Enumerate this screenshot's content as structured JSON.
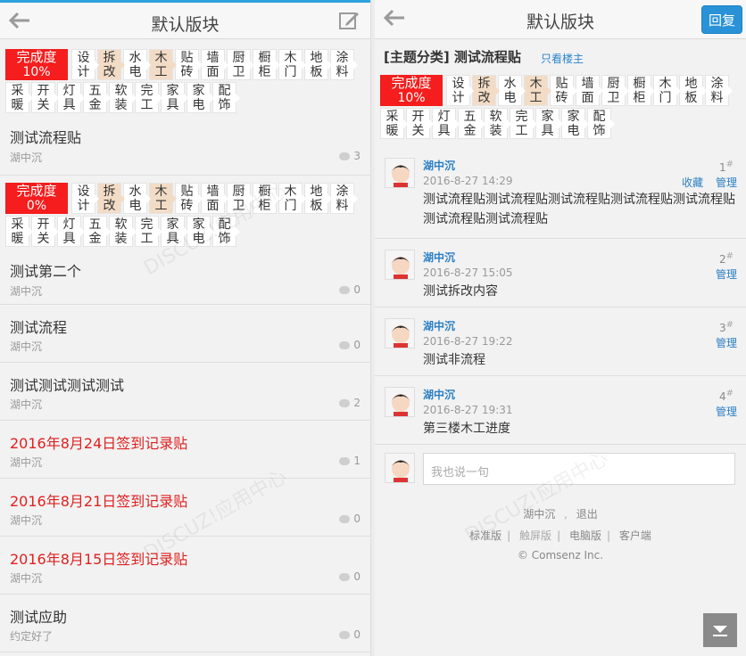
{
  "left": {
    "title": "默认版块",
    "threads": [
      {
        "title": "测试流程贴",
        "author": "湖中沉",
        "replies": "3",
        "red": false,
        "completion": {
          "label": "完成度",
          "pct": "10%"
        }
      },
      {
        "title": "测试第二个",
        "author": "湖中沉",
        "replies": "0",
        "red": false,
        "completion": {
          "label": "完成度",
          "pct": "0%"
        }
      },
      {
        "title": "测试流程",
        "author": "湖中沉",
        "replies": "0",
        "red": false
      },
      {
        "title": "测试测试测试测试",
        "author": "湖中沉",
        "replies": "2",
        "red": false
      },
      {
        "title": "2016年8月24日签到记录贴",
        "author": "湖中沉",
        "replies": "1",
        "red": true
      },
      {
        "title": "2016年8月21日签到记录贴",
        "author": "湖中沉",
        "replies": "0",
        "red": true
      },
      {
        "title": "2016年8月15日签到记录贴",
        "author": "湖中沉",
        "replies": "0",
        "red": true
      },
      {
        "title": "测试应助",
        "author": "约定好了",
        "replies": "0",
        "red": false
      }
    ]
  },
  "steps_row1": [
    "设计",
    "拆改",
    "水电",
    "木工",
    "贴砖",
    "墙面",
    "厨卫",
    "橱柜",
    "木门",
    "地板",
    "涂料"
  ],
  "steps_row2": [
    "采暖",
    "开关",
    "灯具",
    "五金",
    "软装",
    "完工",
    "家具",
    "家电",
    "配饰"
  ],
  "right": {
    "title": "默认版块",
    "reply_label": "回复",
    "post_title": "[主题分类] 测试流程贴",
    "only_op": "只看楼主",
    "completion": {
      "label": "完成度",
      "pct": "10%"
    },
    "posts": [
      {
        "author": "湖中沉",
        "time": "2016-8-27 14:29",
        "floor": "1",
        "actions": [
          "收藏",
          "管理"
        ],
        "content": "测试流程贴测试流程贴测试流程贴测试流程贴测试流程贴测试流程贴测试流程贴"
      },
      {
        "author": "湖中沉",
        "time": "2016-8-27 15:05",
        "floor": "2",
        "actions": [
          "管理"
        ],
        "content": "测试拆改内容"
      },
      {
        "author": "湖中沉",
        "time": "2016-8-27 19:22",
        "floor": "3",
        "actions": [
          "管理"
        ],
        "content": "测试非流程"
      },
      {
        "author": "湖中沉",
        "time": "2016-8-27 19:31",
        "floor": "4",
        "actions": [
          "管理"
        ],
        "content": "第三楼木工进度"
      }
    ],
    "reply_placeholder": "我也说一句",
    "footer": {
      "user": "湖中沉",
      "logout": "退出",
      "links": [
        "标准版",
        "触屏版",
        "电脑版",
        "客户端"
      ],
      "copyright": "© Comsenz Inc."
    }
  },
  "colors": {
    "accent": "#2a93d8",
    "completion": "#f51d1d",
    "done_step": "#f3dcc6",
    "red_title": "#e02020"
  }
}
